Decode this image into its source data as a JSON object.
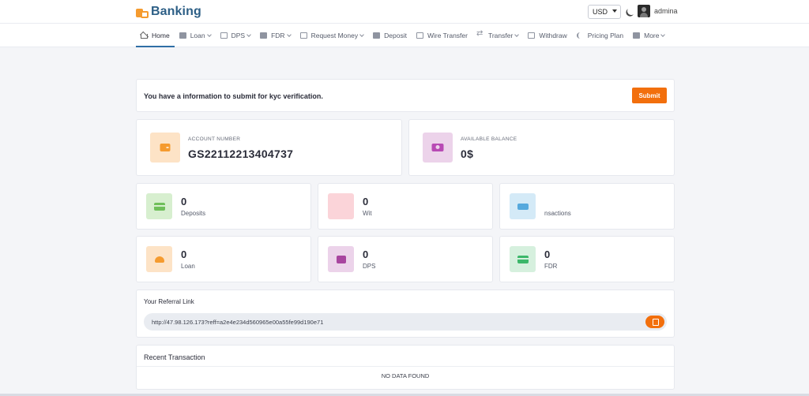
{
  "brand": {
    "name": "Banking"
  },
  "header": {
    "currency": "USD",
    "username": "admina"
  },
  "nav": [
    {
      "label": "Home",
      "icon": "home-icon",
      "dropdown": false,
      "active": true
    },
    {
      "label": "Loan",
      "icon": "loan-icon",
      "dropdown": true
    },
    {
      "label": "DPS",
      "icon": "dps-icon",
      "dropdown": true
    },
    {
      "label": "FDR",
      "icon": "fdr-icon",
      "dropdown": true
    },
    {
      "label": "Request Money",
      "icon": "request-money-icon",
      "dropdown": true
    },
    {
      "label": "Deposit",
      "icon": "deposit-icon",
      "dropdown": false
    },
    {
      "label": "Wire Transfer",
      "icon": "wire-transfer-icon",
      "dropdown": false
    },
    {
      "label": "Transfer",
      "icon": "transfer-icon",
      "dropdown": true
    },
    {
      "label": "Withdraw",
      "icon": "withdraw-icon",
      "dropdown": false
    },
    {
      "label": "Pricing Plan",
      "icon": "pricing-plan-icon",
      "dropdown": false
    },
    {
      "label": "More",
      "icon": "more-icon",
      "dropdown": true
    }
  ],
  "kyc": {
    "message": "You have a information to submit for kyc verification.",
    "button": "Submit"
  },
  "account": {
    "label": "ACCOUNT NUMBER",
    "value": "GS22112213404737"
  },
  "balance": {
    "label": "AVAILABLE BALANCE",
    "value": "0$"
  },
  "stats": [
    {
      "value": "0",
      "label": "Deposits",
      "icon": "deposits-icon"
    },
    {
      "value": "0",
      "label": "Wit",
      "icon": "withdraw-icon"
    },
    {
      "value": "",
      "label": "nsactions",
      "icon": "transactions-icon"
    },
    {
      "value": "0",
      "label": "Loan",
      "icon": "loan-icon"
    },
    {
      "value": "0",
      "label": "DPS",
      "icon": "dps-icon"
    },
    {
      "value": "0",
      "label": "FDR",
      "icon": "fdr-icon"
    }
  ],
  "referral": {
    "title": "Your Referral Link",
    "link": "http://47.98.126.173?reff=a2e4e234d560965e00a55fe99d190e71"
  },
  "recent": {
    "title": "Recent Transaction",
    "empty": "NO DATA FOUND"
  },
  "colors": {
    "accent": "#f26f0d",
    "brand": "#2d5f86",
    "nav_active": "#2f6ea5"
  }
}
